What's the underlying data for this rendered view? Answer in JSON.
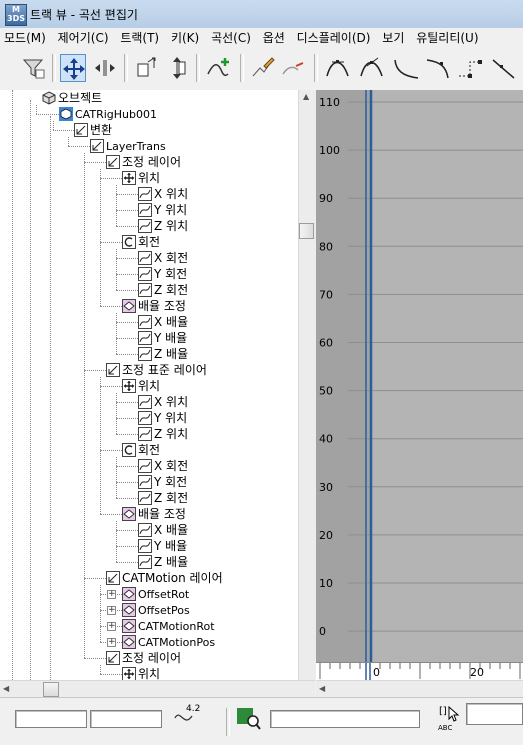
{
  "window": {
    "title": "트랙 뷰 - 곡선 편집기",
    "app_icon_text": "M 3DS"
  },
  "menu": [
    "모드(M)",
    "제어기(C)",
    "트랙(T)",
    "키(K)",
    "곡선(C)",
    "옵션",
    "디스플레이(D)",
    "보기",
    "유틸리티(U)"
  ],
  "toolbar": {
    "buttons": [
      "filter-button",
      "move-keys-button",
      "slide-keys-button",
      "scale-keys-button",
      "scale-values-button",
      "add-keys-button",
      "draw-curves-button",
      "reduce-keys-button",
      "tangent-auto-button",
      "tangent-custom-button",
      "tangent-fast-button",
      "tangent-slow-button",
      "tangent-step-button",
      "tangent-linear-button"
    ]
  },
  "tree": {
    "nodes": [
      {
        "label": "오브젝트",
        "icon": "object-icon",
        "expander": "-"
      },
      {
        "label": "CATRigHub001",
        "icon": "cat-hub-icon",
        "expander": "-"
      },
      {
        "label": "변환",
        "icon": "transform-icon",
        "expander": "-"
      },
      {
        "label": "LayerTrans",
        "icon": "layer-trans-icon",
        "expander": "-"
      },
      {
        "label": "조정 레이어",
        "icon": "layer-icon",
        "expander": "-"
      },
      {
        "label": "위치",
        "icon": "position-icon",
        "expander": "-"
      },
      {
        "label": "X 위치",
        "icon": "curve-icon"
      },
      {
        "label": "Y 위치",
        "icon": "curve-icon"
      },
      {
        "label": "Z 위치",
        "icon": "curve-icon"
      },
      {
        "label": "회전",
        "icon": "rotation-icon",
        "expander": "-"
      },
      {
        "label": "X 회전",
        "icon": "curve-icon"
      },
      {
        "label": "Y 회전",
        "icon": "curve-icon"
      },
      {
        "label": "Z 회전",
        "icon": "curve-icon"
      },
      {
        "label": "배율 조정",
        "icon": "scale-icon",
        "expander": "-"
      },
      {
        "label": "X 배율",
        "icon": "curve-icon"
      },
      {
        "label": "Y 배율",
        "icon": "curve-icon"
      },
      {
        "label": "Z 배율",
        "icon": "curve-icon"
      },
      {
        "label": "조정 표준 레이어",
        "icon": "layer-icon",
        "expander": "-"
      },
      {
        "label": "위치",
        "icon": "position-icon",
        "expander": "-"
      },
      {
        "label": "X 위치",
        "icon": "curve-icon"
      },
      {
        "label": "Y 위치",
        "icon": "curve-icon"
      },
      {
        "label": "Z 위치",
        "icon": "curve-icon"
      },
      {
        "label": "회전",
        "icon": "rotation-icon",
        "expander": "-"
      },
      {
        "label": "X 회전",
        "icon": "curve-icon"
      },
      {
        "label": "Y 회전",
        "icon": "curve-icon"
      },
      {
        "label": "Z 회전",
        "icon": "curve-icon"
      },
      {
        "label": "배율 조정",
        "icon": "scale-icon",
        "expander": "-"
      },
      {
        "label": "X 배율",
        "icon": "curve-icon"
      },
      {
        "label": "Y 배율",
        "icon": "curve-icon"
      },
      {
        "label": "Z 배율",
        "icon": "curve-icon"
      },
      {
        "label": "CATMotion 레이어",
        "icon": "layer-icon",
        "expander": "-"
      },
      {
        "label": "OffsetRot",
        "icon": "scale-icon",
        "expander": "+"
      },
      {
        "label": "OffsetPos",
        "icon": "scale-icon",
        "expander": "+"
      },
      {
        "label": "CATMotionRot",
        "icon": "scale-icon",
        "expander": "+"
      },
      {
        "label": "CATMotionPos",
        "icon": "scale-icon",
        "expander": "+"
      },
      {
        "label": "조정 레이어",
        "icon": "layer-icon",
        "expander": "-"
      },
      {
        "label": "위치",
        "icon": "position-icon",
        "expander": "-"
      }
    ]
  },
  "graph": {
    "y_ticks": [
      "110",
      "100",
      "90",
      "80",
      "70",
      "60",
      "50",
      "40",
      "30",
      "20",
      "10",
      "0"
    ],
    "x_ticks": [
      "0",
      "20"
    ],
    "colors": {
      "background": "#a2a2a2",
      "active_range": "#b4b4b4",
      "gridline": "#8e8e8e",
      "time_slider": "#2a5d9c"
    }
  },
  "statusbar": {
    "key_time_value": "",
    "key_value_value": "",
    "tangent_label": "4.2",
    "search_value": "",
    "abc_label": "ABC",
    "extra_value": ""
  }
}
